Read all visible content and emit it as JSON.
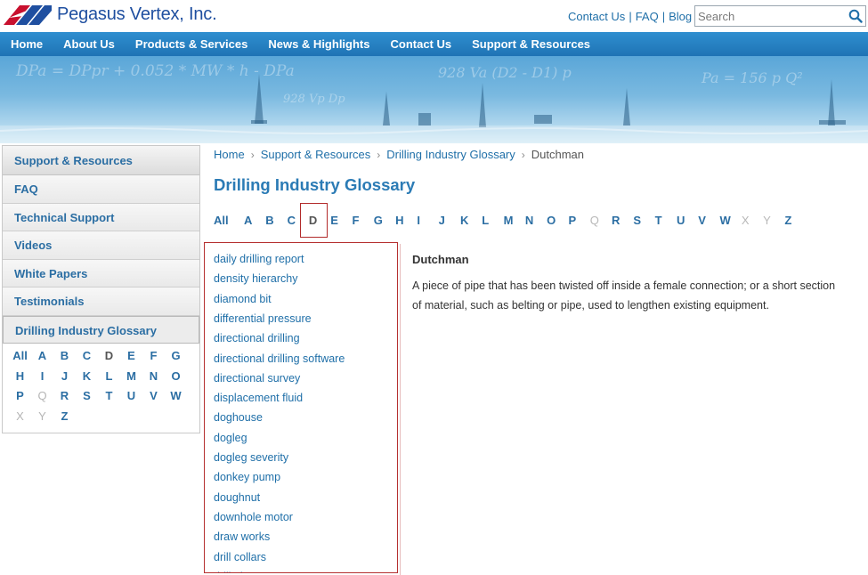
{
  "header": {
    "company": "Pegasus Vertex, Inc.",
    "links": [
      "Contact Us",
      "FAQ",
      "Blog"
    ],
    "search_placeholder": "Search"
  },
  "nav": [
    "Home",
    "About Us",
    "Products & Services",
    "News & Highlights",
    "Contact Us",
    "Support & Resources"
  ],
  "banner": {
    "formulas": [
      "DPa = DPpr + 0.052 * MW * h - DPa",
      "928 Va (D2 - D1) p",
      "Pa = 156 p Q²",
      "928 Vp Dp"
    ]
  },
  "sidebar": {
    "heading": "Support & Resources",
    "items": [
      "FAQ",
      "Technical Support",
      "Videos",
      "White Papers",
      "Testimonials",
      "Drilling Industry Glossary"
    ],
    "letters": [
      "All",
      "A",
      "B",
      "C",
      "D",
      "E",
      "F",
      "G",
      "H",
      "I",
      "J",
      "K",
      "L",
      "M",
      "N",
      "O",
      "P",
      "Q",
      "R",
      "S",
      "T",
      "U",
      "V",
      "W",
      "X",
      "Y",
      "Z"
    ]
  },
  "breadcrumb": [
    "Home",
    "Support & Resources",
    "Drilling Industry Glossary",
    "Dutchman"
  ],
  "page_title": "Drilling Industry Glossary",
  "alphabet": [
    "All",
    "A",
    "B",
    "C",
    "D",
    "E",
    "F",
    "G",
    "H",
    "I",
    "J",
    "K",
    "L",
    "M",
    "N",
    "O",
    "P",
    "Q",
    "R",
    "S",
    "T",
    "U",
    "V",
    "W",
    "X",
    "Y",
    "Z"
  ],
  "disabled_letters": [
    "Q",
    "X",
    "Y"
  ],
  "current_letter": "D",
  "terms": [
    "daily drilling report",
    "density hierarchy",
    "diamond bit",
    "differential pressure",
    "directional drilling",
    "directional drilling software",
    "directional survey",
    "displacement fluid",
    "doghouse",
    "dogleg",
    "dogleg severity",
    "donkey pump",
    "doughnut",
    "downhole motor",
    "draw works",
    "drill collars",
    "drill pipe"
  ],
  "definition": {
    "term": "Dutchman",
    "text": "A piece of pipe that has been twisted off inside a female connection; or a short section of material, such as belting or pipe, used to lengthen existing equipment."
  },
  "colors": {
    "brand_blue": "#1f4fa0",
    "link_blue": "#1f6fa8",
    "nav_blue": "#1f73b5",
    "highlight_red": "#b22a2a",
    "logo_red": "#c8102e"
  }
}
